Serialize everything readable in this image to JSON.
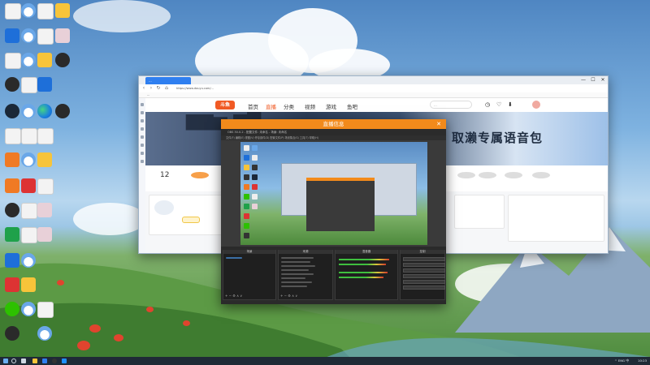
{
  "browser": {
    "tab_title": "...",
    "url": "https://www.douyu.com/...",
    "bookmarks": "...",
    "site": {
      "logo_text": "斗鱼",
      "nav": [
        "首页",
        "直播",
        "分类",
        "视频",
        "游戏",
        "鱼吧"
      ],
      "search_placeholder": "...",
      "banner_text": "取濑专属语音包",
      "quick_count": "12"
    },
    "controls": {
      "minimize": "—",
      "maximize": "☐",
      "close": "✕"
    }
  },
  "preview_window": {
    "title": "直播信息",
    "close": "✕",
    "inner_title": "OBS 30.0.2 - 配置文件: 未命名 - 场景: 未命名",
    "menu": "文件(F) 编辑(E) 视图(V) 停靠部件(D) 配置文件(P) 场景集合(S) 工具(T) 帮助(H)",
    "docks": {
      "scenes_header": "场景",
      "sources_header": "来源",
      "mixer_header": "混音器",
      "controls_header": "控制"
    }
  },
  "taskbar": {
    "tray_text": "^ ENG 中",
    "clock": "10:23"
  },
  "colors": {
    "obs_accent": "#f28a1b",
    "douyu_accent": "#f15a24",
    "browser_tab": "#2f7ff0"
  },
  "icons": [
    "document-icon",
    "cloud-icon",
    "document-icon",
    "sun-app-icon",
    "computer-icon",
    "cloud-icon",
    "app-icon",
    "shortcut-icon",
    "recycle-bin-icon",
    "cloud-icon",
    "avatar-app-icon",
    "game-icon",
    "obs-icon",
    "app-icon",
    "docs-icon",
    "steam-icon",
    "cloud-icon",
    "edge-icon",
    "xbox-icon",
    "wechat-icon"
  ]
}
